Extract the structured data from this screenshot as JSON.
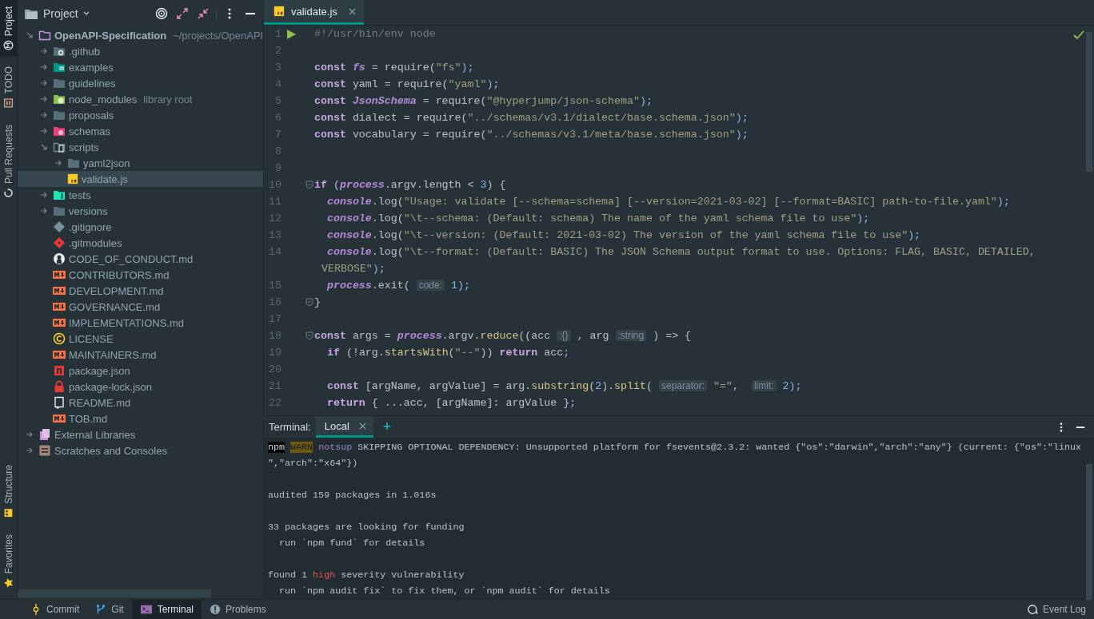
{
  "tool_strip": {
    "top": [
      {
        "label": "Project",
        "kind": "project",
        "selected": true
      },
      {
        "label": "TODO",
        "kind": "todo",
        "selected": false
      },
      {
        "label": "Pull Requests",
        "kind": "pull",
        "selected": false
      }
    ],
    "bottom": [
      {
        "label": "Structure",
        "kind": "structure",
        "selected": false
      },
      {
        "label": "Favorites",
        "kind": "favorites",
        "selected": false
      }
    ]
  },
  "project_panel": {
    "title": "Project",
    "tree": [
      {
        "label": "OpenAPI-Specification",
        "suffix": "~/projects/OpenAPI",
        "kind": "project-folder",
        "expanded": true,
        "selected": false,
        "children": [
          {
            "label": ".github",
            "kind": "folder-github",
            "expanded": false,
            "selected": false
          },
          {
            "label": "examples",
            "kind": "folder-images",
            "expanded": false,
            "selected": false
          },
          {
            "label": "guidelines",
            "kind": "folder",
            "expanded": false,
            "selected": false
          },
          {
            "label": "node_modules",
            "suffix": "library root",
            "kind": "folder-node",
            "expanded": false,
            "selected": false
          },
          {
            "label": "proposals",
            "kind": "folder",
            "expanded": false,
            "selected": false
          },
          {
            "label": "schemas",
            "kind": "folder-schemas",
            "expanded": false,
            "selected": false
          },
          {
            "label": "scripts",
            "kind": "folder-scripts",
            "expanded": true,
            "selected": false,
            "children": [
              {
                "label": "yaml2json",
                "kind": "folder",
                "expanded": false,
                "selected": false
              },
              {
                "label": "validate.js",
                "kind": "js",
                "selected": true
              }
            ]
          },
          {
            "label": "tests",
            "kind": "folder-tests",
            "expanded": false,
            "selected": false
          },
          {
            "label": "versions",
            "kind": "folder",
            "expanded": false,
            "selected": false
          },
          {
            "label": ".gitignore",
            "kind": "gitignore",
            "selected": false
          },
          {
            "label": ".gitmodules",
            "kind": "gitmodules",
            "selected": false
          },
          {
            "label": "CODE_OF_CONDUCT.md",
            "kind": "github",
            "selected": false
          },
          {
            "label": "CONTRIBUTORS.md",
            "kind": "markdown",
            "selected": false
          },
          {
            "label": "DEVELOPMENT.md",
            "kind": "markdown",
            "selected": false
          },
          {
            "label": "GOVERNANCE.md",
            "kind": "markdown",
            "selected": false
          },
          {
            "label": "IMPLEMENTATIONS.md",
            "kind": "markdown",
            "selected": false
          },
          {
            "label": "LICENSE",
            "kind": "license",
            "selected": false
          },
          {
            "label": "MAINTAINERS.md",
            "kind": "markdown",
            "selected": false
          },
          {
            "label": "package.json",
            "kind": "npm",
            "selected": false
          },
          {
            "label": "package-lock.json",
            "kind": "lock",
            "selected": false
          },
          {
            "label": "README.md",
            "kind": "readme",
            "selected": false
          },
          {
            "label": "TOB.md",
            "kind": "markdown",
            "selected": false
          }
        ]
      },
      {
        "label": "External Libraries",
        "kind": "libraries",
        "expanded": false,
        "selected": false
      },
      {
        "label": "Scratches and Consoles",
        "kind": "scratches",
        "expanded": false,
        "selected": false
      }
    ]
  },
  "editor": {
    "tabs": [
      {
        "label": "validate.js",
        "kind": "js",
        "selected": true
      }
    ],
    "lines": [
      {
        "num": "1",
        "run": true,
        "fold": false,
        "tokens": [
          {
            "kind": "comment",
            "text": "#!/usr/bin/env node"
          }
        ]
      },
      {
        "num": "2",
        "run": false,
        "fold": false
      },
      {
        "num": "3",
        "run": false,
        "fold": false,
        "tokens": [
          {
            "kind": "kw",
            "text": "const"
          },
          {
            "kind": "ital",
            "text": " fs"
          },
          {
            "kind": "plain",
            "text": " = require("
          },
          {
            "kind": "str",
            "text": "\"fs\""
          },
          {
            "kind": "punc",
            "text": ");"
          }
        ]
      },
      {
        "num": "4",
        "run": false,
        "fold": false,
        "tokens": [
          {
            "kind": "kw",
            "text": "const"
          },
          {
            "kind": "plain",
            "text": " yaml = require("
          },
          {
            "kind": "str",
            "text": "\"yaml\""
          },
          {
            "kind": "punc",
            "text": ");"
          }
        ]
      },
      {
        "num": "5",
        "run": false,
        "fold": false,
        "tokens": [
          {
            "kind": "kw",
            "text": "const"
          },
          {
            "kind": "ital",
            "text": " JsonSchema"
          },
          {
            "kind": "plain",
            "text": " = require("
          },
          {
            "kind": "str",
            "text": "\"@hyperjump/json-schema\""
          },
          {
            "kind": "punc",
            "text": ");"
          }
        ]
      },
      {
        "num": "6",
        "run": false,
        "fold": false,
        "tokens": [
          {
            "kind": "kw",
            "text": "const"
          },
          {
            "kind": "plain",
            "text": " dialect = require("
          },
          {
            "kind": "str",
            "text": "\"../schemas/v3.1/dialect/base.schema.json\""
          },
          {
            "kind": "punc",
            "text": ");"
          }
        ]
      },
      {
        "num": "7",
        "run": false,
        "fold": false,
        "tokens": [
          {
            "kind": "kw",
            "text": "const"
          },
          {
            "kind": "plain",
            "text": " vocabulary = require("
          },
          {
            "kind": "str",
            "text": "\"../schemas/v3.1/meta/base.schema.json\""
          },
          {
            "kind": "punc",
            "text": ");"
          }
        ]
      },
      {
        "num": "8",
        "run": false,
        "fold": false
      },
      {
        "num": "9",
        "run": false,
        "fold": false
      },
      {
        "num": "10",
        "run": false,
        "fold": true,
        "tokens": [
          {
            "kind": "kw",
            "text": "if"
          },
          {
            "kind": "plain",
            "text": " ("
          },
          {
            "kind": "ital",
            "text": "process"
          },
          {
            "kind": "plain",
            "text": ".argv.length < "
          },
          {
            "kind": "num",
            "text": "3"
          },
          {
            "kind": "plain",
            "text": ") {"
          }
        ]
      },
      {
        "num": "11",
        "run": false,
        "fold": false,
        "tokens": [
          {
            "kind": "ital",
            "text": "  console"
          },
          {
            "kind": "plain",
            "text": ".log("
          },
          {
            "kind": "str",
            "text": "\"Usage: validate [--schema=schema] [--version=2021-03-02] [--format=BASIC] path-to-file.yaml\""
          },
          {
            "kind": "punc",
            "text": ");"
          }
        ]
      },
      {
        "num": "12",
        "run": false,
        "fold": false,
        "tokens": [
          {
            "kind": "ital",
            "text": "  console"
          },
          {
            "kind": "plain",
            "text": ".log("
          },
          {
            "kind": "str",
            "text": "\"\\t--schema: (Default: schema) The name of the yaml schema file to use\""
          },
          {
            "kind": "punc",
            "text": ");"
          }
        ]
      },
      {
        "num": "13",
        "run": false,
        "fold": false,
        "tokens": [
          {
            "kind": "ital",
            "text": "  console"
          },
          {
            "kind": "plain",
            "text": ".log("
          },
          {
            "kind": "str",
            "text": "\"\\t--version: (Default: 2021-03-02) The version of the yaml schema file to use\""
          },
          {
            "kind": "punc",
            "text": ");"
          }
        ]
      },
      {
        "num": "14",
        "run": false,
        "fold": false,
        "tokens": [
          {
            "kind": "ital",
            "text": "  console"
          },
          {
            "kind": "plain",
            "text": ".log("
          },
          {
            "kind": "str",
            "text": "\"\\t--format: (Default: BASIC) The JSON Schema output format to use. Options: FLAG, BASIC, DETAILED,"
          }
        ],
        "continued": [
          {
            "kind": "str",
            "text": "VERBOSE\""
          },
          {
            "kind": "punc",
            "text": ");"
          }
        ]
      },
      {
        "num": "15",
        "run": false,
        "fold": false,
        "tokens": [
          {
            "kind": "ital",
            "text": "  process"
          },
          {
            "kind": "plain",
            "text": ".exit( "
          },
          {
            "kind": "hint",
            "text": "code:"
          },
          {
            "kind": "num",
            "text": " 1"
          },
          {
            "kind": "punc",
            "text": ");"
          }
        ]
      },
      {
        "num": "16",
        "run": false,
        "fold": true,
        "tokens": [
          {
            "kind": "plain",
            "text": "}"
          }
        ]
      },
      {
        "num": "17",
        "run": false,
        "fold": false
      },
      {
        "num": "18",
        "run": false,
        "fold": true,
        "tokens": [
          {
            "kind": "kw",
            "text": "const"
          },
          {
            "kind": "plain",
            "text": " args = "
          },
          {
            "kind": "ital",
            "text": "process"
          },
          {
            "kind": "plain",
            "text": ".argv."
          },
          {
            "kind": "fn",
            "text": "reduce"
          },
          {
            "kind": "plain",
            "text": "((acc "
          },
          {
            "kind": "hint",
            "text": ":{}"
          },
          {
            "kind": "plain",
            "text": " , arg "
          },
          {
            "kind": "hint",
            "text": ":string"
          },
          {
            "kind": "plain",
            "text": " ) => {"
          }
        ]
      },
      {
        "num": "19",
        "run": false,
        "fold": false,
        "tokens": [
          {
            "kind": "kw",
            "text": "  if"
          },
          {
            "kind": "plain",
            "text": " (!arg."
          },
          {
            "kind": "fn",
            "text": "startsWith"
          },
          {
            "kind": "plain",
            "text": "("
          },
          {
            "kind": "str",
            "text": "\"--\""
          },
          {
            "kind": "plain",
            "text": ")) "
          },
          {
            "kind": "kw",
            "text": "return"
          },
          {
            "kind": "plain",
            "text": " acc"
          },
          {
            "kind": "punc",
            "text": ";"
          }
        ]
      },
      {
        "num": "20",
        "run": false,
        "fold": false
      },
      {
        "num": "21",
        "run": false,
        "fold": false,
        "tokens": [
          {
            "kind": "kw",
            "text": "  const"
          },
          {
            "kind": "plain",
            "text": " [argName, argValue] = arg."
          },
          {
            "kind": "fn",
            "text": "substring"
          },
          {
            "kind": "plain",
            "text": "("
          },
          {
            "kind": "num",
            "text": "2"
          },
          {
            "kind": "plain",
            "text": ")."
          },
          {
            "kind": "fn",
            "text": "split"
          },
          {
            "kind": "plain",
            "text": "( "
          },
          {
            "kind": "hint",
            "text": "separator:"
          },
          {
            "kind": "str",
            "text": " \"=\""
          },
          {
            "kind": "plain",
            "text": ",  "
          },
          {
            "kind": "hint",
            "text": "limit:"
          },
          {
            "kind": "num",
            "text": " 2"
          },
          {
            "kind": "punc",
            "text": ");"
          }
        ]
      },
      {
        "num": "22",
        "run": false,
        "fold": false,
        "tokens": [
          {
            "kind": "kw",
            "text": "  return"
          },
          {
            "kind": "plain",
            "text": " { ...acc, [argName]: argValue }"
          },
          {
            "kind": "punc",
            "text": ";"
          }
        ]
      }
    ]
  },
  "terminal": {
    "label": "Terminal:",
    "tabs": [
      {
        "label": "Local",
        "selected": true
      }
    ],
    "add": "+",
    "blocks": [
      {
        "lines": [
          {
            "tokens": [
              {
                "kind": "npm",
                "text": "npm"
              },
              {
                "kind": "warn",
                "text": " WARN"
              },
              {
                "kind": "notsup",
                "text": " notsup"
              },
              {
                "kind": "plain",
                "text": " SKIPPING OPTIONAL DEPENDENCY: Unsupported platform for fsevents@2.3.2: wanted {\"os\":\"darwin\",\"arch\":\"any\"} (current: {\"os\":\"linux"
              }
            ]
          },
          {
            "tokens": [
              {
                "kind": "plain",
                "text": "\",\"arch\":\"x64\"})"
              }
            ]
          }
        ]
      },
      {
        "lines": [
          {
            "tokens": [
              {
                "kind": "plain",
                "text": "audited 159 packages in 1.016s"
              }
            ]
          }
        ]
      },
      {
        "lines": [
          {
            "tokens": [
              {
                "kind": "plain",
                "text": "33 packages are looking for funding"
              }
            ]
          },
          {
            "tokens": [
              {
                "kind": "plain",
                "text": "  run `npm fund` for details"
              }
            ]
          }
        ]
      },
      {
        "lines": [
          {
            "tokens": [
              {
                "kind": "plain",
                "text": "found 1 "
              },
              {
                "kind": "error",
                "text": "high"
              },
              {
                "kind": "plain",
                "text": " severity vulnerability"
              }
            ]
          },
          {
            "tokens": [
              {
                "kind": "plain",
                "text": "  run `npm audit fix` to fix them, or `npm audit` for details"
              }
            ]
          }
        ]
      }
    ]
  },
  "status_bar": {
    "items": [
      {
        "label": "Commit",
        "kind": "commit",
        "selected": false
      },
      {
        "label": "Git",
        "kind": "git",
        "selected": false
      },
      {
        "label": "Terminal",
        "kind": "terminal",
        "selected": true
      },
      {
        "label": "Problems",
        "kind": "problems",
        "selected": false
      }
    ],
    "right": {
      "label": "Event Log",
      "kind": "event"
    }
  }
}
